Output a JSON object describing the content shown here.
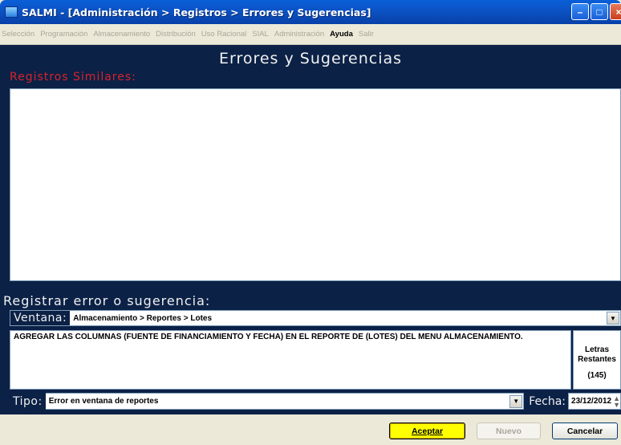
{
  "window": {
    "title": "SALMI - [Administración > Registros > Errores y Sugerencias]"
  },
  "menu": [
    {
      "label": "Selección",
      "active": false
    },
    {
      "label": "Programación",
      "active": false
    },
    {
      "label": "Almacenamiento",
      "active": false
    },
    {
      "label": "Distribución",
      "active": false
    },
    {
      "label": "Uso Racional",
      "active": false
    },
    {
      "label": "SIAL",
      "active": false
    },
    {
      "label": "Administración",
      "active": false
    },
    {
      "label": "Ayuda",
      "active": true
    },
    {
      "label": "Salir",
      "active": false
    }
  ],
  "panel": {
    "title": "Errores y Sugerencias",
    "similar_label": "Registros Similares:",
    "register_label": "Registrar error o sugerencia:"
  },
  "form": {
    "ventana_label": "Ventana:",
    "ventana_value": "Almacenamiento > Reportes > Lotes",
    "text": "AGREGAR LAS COLUMNAS (FUENTE DE FINANCIAMIENTO Y FECHA) EN EL REPORTE DE (LOTES) DEL MENU ALMACENAMIENTO.",
    "letras_label": "Letras Restantes",
    "letras_count": "(145)",
    "tipo_label": "Tipo:",
    "tipo_value": "Error en ventana de reportes",
    "fecha_label": "Fecha:",
    "fecha_value": "23/12/2012"
  },
  "buttons": {
    "accept": "Aceptar",
    "new": "Nuevo",
    "cancel": "Cancelar"
  },
  "colors": {
    "panel_bg": "#0b2146",
    "accent_red": "#d8222a",
    "accept_yellow": "#ffff00"
  }
}
